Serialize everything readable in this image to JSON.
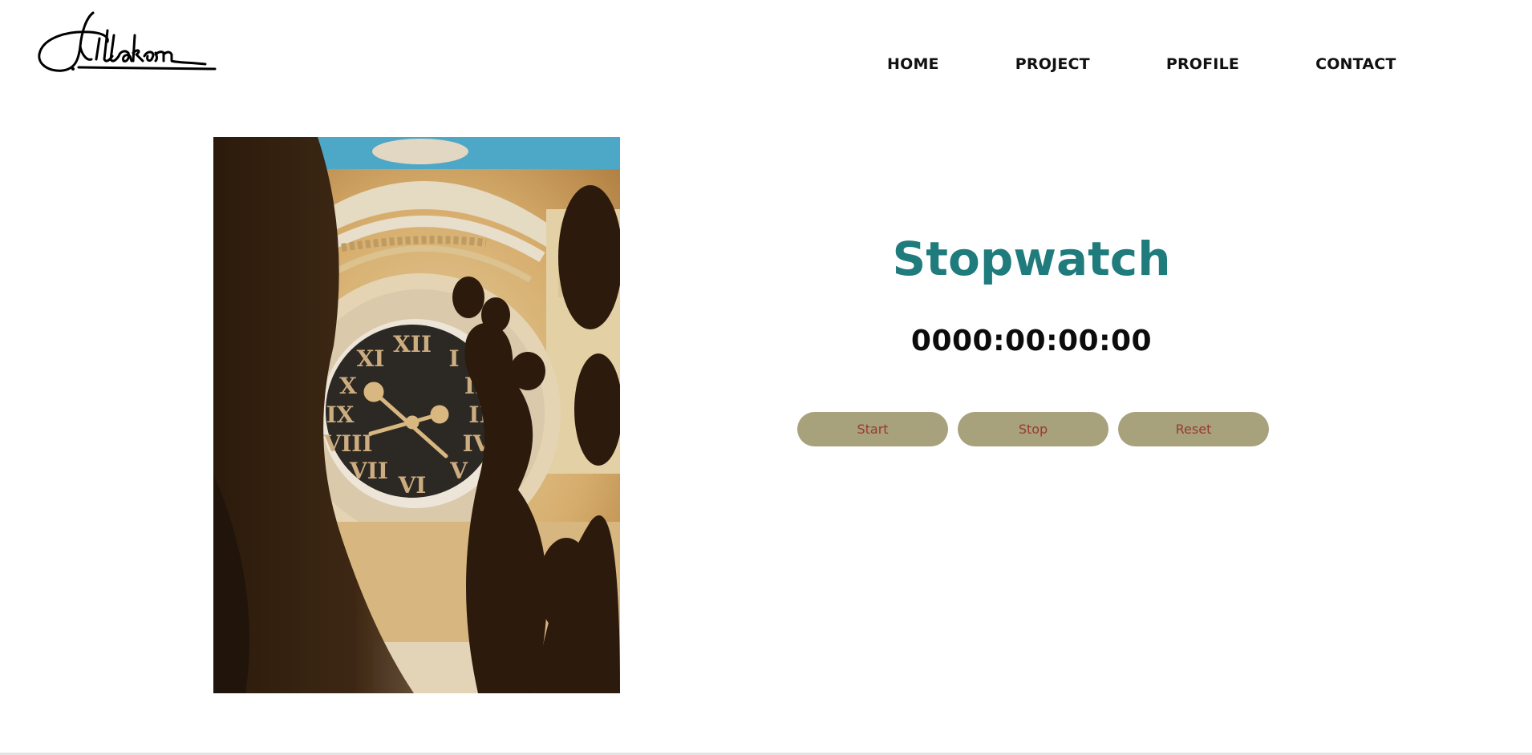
{
  "header": {
    "logo_alt": "Jittakorn signature",
    "nav": {
      "home": "HOME",
      "project": "PROJECT",
      "profile": "PROFILE",
      "contact": "CONTACT"
    }
  },
  "hero": {
    "alt": "Clock tower with roman numerals seen through shadowed foliage"
  },
  "stopwatch": {
    "title": "Stopwatch",
    "display": "0000:00:00:00",
    "buttons": {
      "start": "Start",
      "stop": "Stop",
      "reset": "Reset"
    }
  },
  "colors": {
    "title": "#1f7b7c",
    "button_bg": "#a7a17c",
    "button_text": "#9a3a2e",
    "nav_text": "#111111"
  }
}
